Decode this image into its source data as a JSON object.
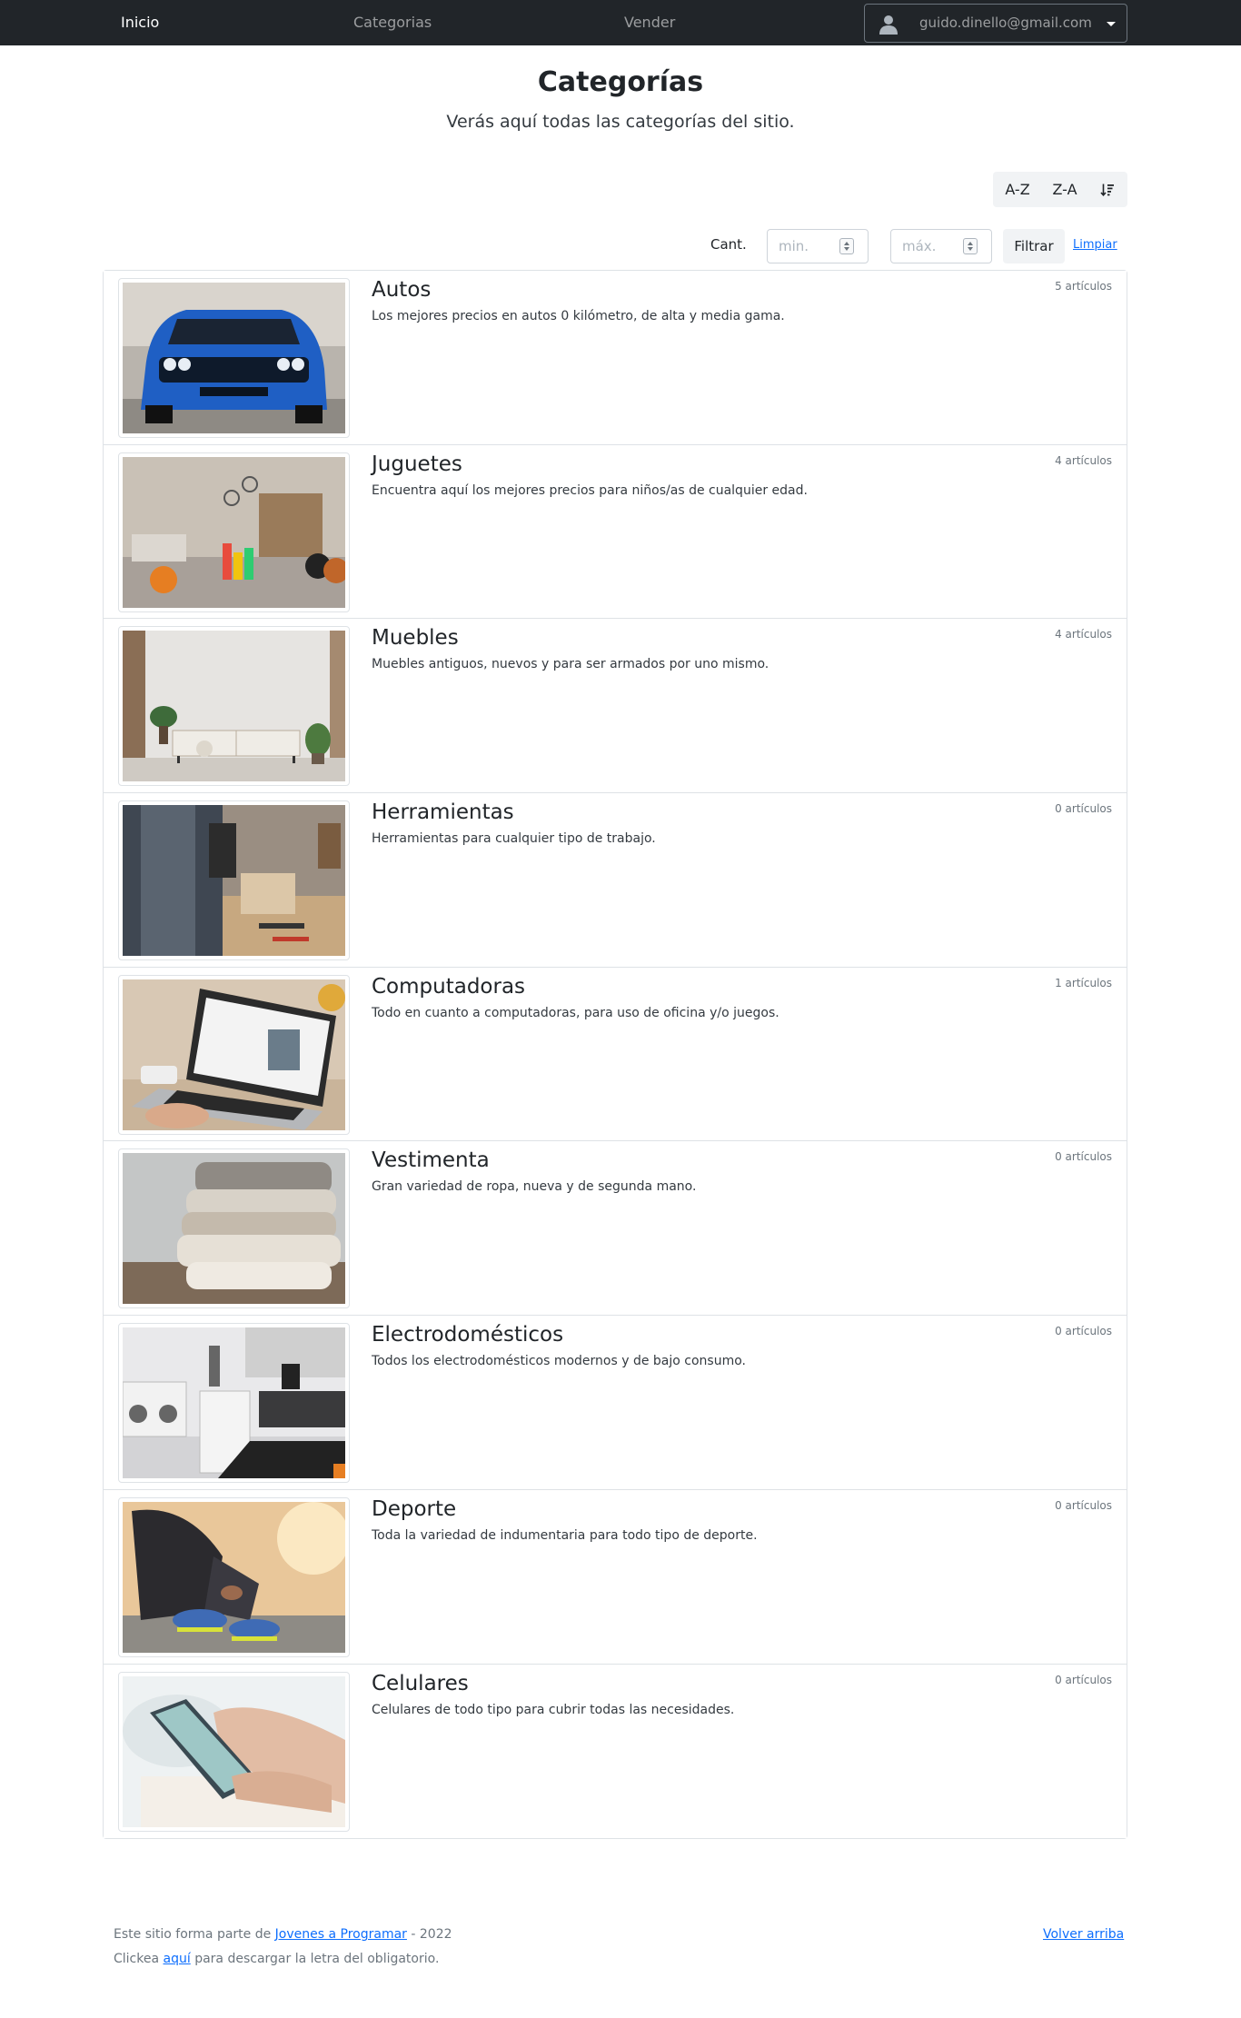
{
  "nav": {
    "inicio": "Inicio",
    "categorias": "Categorias",
    "vender": "Vender",
    "user_email": "guido.dinello@gmail.com",
    "icons": {
      "avatar": "user-avatar-icon",
      "caret": "caret-down-icon"
    }
  },
  "header": {
    "title": "Categorías",
    "subtitle": "Verás aquí todas las categorías del sitio."
  },
  "sort": {
    "az": "A-Z",
    "za": "Z-A",
    "count_icon": "sort-amount-down-icon"
  },
  "filter": {
    "label": "Cant.",
    "min_placeholder": "min.",
    "max_placeholder": "máx.",
    "button": "Filtrar",
    "clear": "Limpiar"
  },
  "categories": [
    {
      "name": "Autos",
      "description": "Los mejores precios en autos 0 kilómetro, de alta y media gama.",
      "count": "5 artículos"
    },
    {
      "name": "Juguetes",
      "description": "Encuentra aquí los mejores precios para niños/as de cualquier edad.",
      "count": "4 artículos"
    },
    {
      "name": "Muebles",
      "description": "Muebles antiguos, nuevos y para ser armados por uno mismo.",
      "count": "4 artículos"
    },
    {
      "name": "Herramientas",
      "description": "Herramientas para cualquier tipo de trabajo.",
      "count": "0 artículos"
    },
    {
      "name": "Computadoras",
      "description": "Todo en cuanto a computadoras, para uso de oficina y/o juegos.",
      "count": "1 artículos"
    },
    {
      "name": "Vestimenta",
      "description": "Gran variedad de ropa, nueva y de segunda mano.",
      "count": "0 artículos"
    },
    {
      "name": "Electrodomésticos",
      "description": "Todos los electrodomésticos modernos y de bajo consumo.",
      "count": "0 artículos"
    },
    {
      "name": "Deporte",
      "description": "Toda la variedad de indumentaria para todo tipo de deporte.",
      "count": "0 artículos"
    },
    {
      "name": "Celulares",
      "description": "Celulares de todo tipo para cubrir todas las necesidades.",
      "count": "0 artículos"
    }
  ],
  "footer": {
    "line1_prefix": "Este sitio forma parte de ",
    "line1_link": "Jovenes a Programar",
    "line1_suffix": " - 2022",
    "line2_prefix": "Clickea ",
    "line2_link": "aquí",
    "line2_suffix": " para descargar la letra del obligatorio.",
    "back_to_top": "Volver arriba"
  },
  "colors": {
    "navbar": "#212529",
    "link": "#0d6efd",
    "border": "#dee2e6"
  }
}
